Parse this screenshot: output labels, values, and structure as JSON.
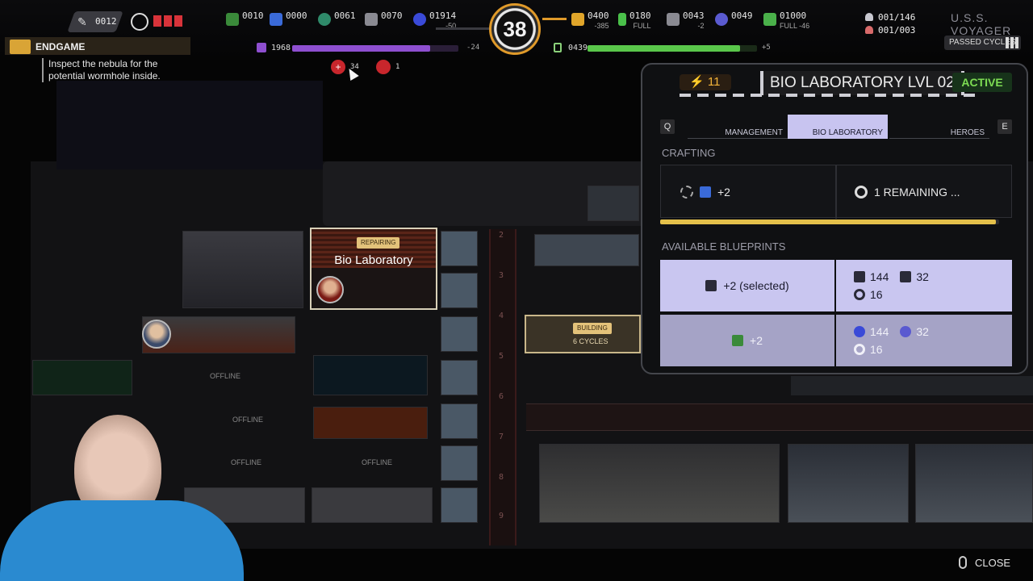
{
  "hud": {
    "crew_icon": "wrench-icon",
    "crew_count": "0012",
    "targets_icon": "crosshair-icon",
    "resources": [
      {
        "name": "bio",
        "icon": "leaf-icon",
        "value": "0010",
        "sub": ""
      },
      {
        "name": "chips",
        "icon": "chip-icon",
        "value": "0000",
        "sub": ""
      },
      {
        "name": "research",
        "icon": "molecule-icon",
        "value": "0061",
        "sub": ""
      },
      {
        "name": "parts",
        "icon": "parts-icon",
        "value": "0070",
        "sub": ""
      },
      {
        "name": "dilithium",
        "icon": "dilithium-icon",
        "value": "01914",
        "sub": "-50"
      },
      {
        "name": "energy",
        "icon": "bolt-icon",
        "value": "0400",
        "sub": "-385"
      },
      {
        "name": "battery",
        "icon": "battery-icon",
        "value": "0180",
        "sub": "FULL"
      },
      {
        "name": "alloy",
        "icon": "ingot-icon",
        "value": "0043",
        "sub": "-2"
      },
      {
        "name": "brain",
        "icon": "brain-icon",
        "value": "0049",
        "sub": ""
      },
      {
        "name": "food",
        "icon": "food-icon",
        "value": "01000",
        "sub": "FULL -46"
      }
    ],
    "cycle_number": "38",
    "crew_pop": "001/146",
    "officers_pop": "001/003",
    "ship_name": "U.S.S. VOYAGER",
    "passed_cycles_label": "PASSED CYCLES",
    "morale_value": "1968",
    "morale_delta": "-24",
    "morale_fill": 0.83,
    "hull_value": "0439",
    "hull_delta": "+5",
    "hull_fill": 0.9
  },
  "mission": {
    "title": "ENDGAME",
    "description": "Inspect the nebula for the potential wormhole inside."
  },
  "alerts": {
    "medical_count": "34",
    "red_alert_count": "1"
  },
  "ship": {
    "room_label": "Bio Laboratory",
    "room_status": "REPAIRING",
    "building_status": "BUILDING",
    "building_cycles": "6 CYCLES",
    "offline_label": "OFFLINE",
    "deck_numbers": [
      "2",
      "3",
      "4",
      "5",
      "6",
      "7",
      "8",
      "9"
    ]
  },
  "panel": {
    "energy": "11",
    "title": "BIO LABORATORY LVL 02",
    "status": "ACTIVE",
    "tabs": [
      "MANAGEMENT",
      "BIO LABORATORY",
      "HEROES"
    ],
    "key_prev": "Q",
    "key_next": "E",
    "crafting_label": "CRAFTING",
    "crafting_item": "+2",
    "crafting_remaining": "1 REMAINING ...",
    "crafting_progress": 0.99,
    "blueprints_label": "AVAILABLE BLUEPRINTS",
    "blueprints": [
      {
        "output": "+2  (selected)",
        "output_icon": "chip-icon",
        "cost_a": "144",
        "cost_a_icon": "research-icon",
        "cost_b": "32",
        "cost_b_icon": "parts-icon",
        "cycles": "16"
      },
      {
        "output": "+2",
        "output_icon": "leaf-icon",
        "cost_a": "144",
        "cost_a_icon": "dilithium-icon",
        "cost_b": "32",
        "cost_b_icon": "brain-icon",
        "cycles": "16"
      }
    ]
  },
  "footer": {
    "close_label": "CLOSE"
  },
  "colors": {
    "accent_orange": "#e09a2a",
    "active_green": "#7ddc53",
    "tab_selected": "#c8c4f0",
    "blueprint_selected": "#c9c6f0",
    "blueprint_normal": "#a5a3c6",
    "morale_bar": "#8e4fd0",
    "hull_bar": "#59c64a"
  }
}
